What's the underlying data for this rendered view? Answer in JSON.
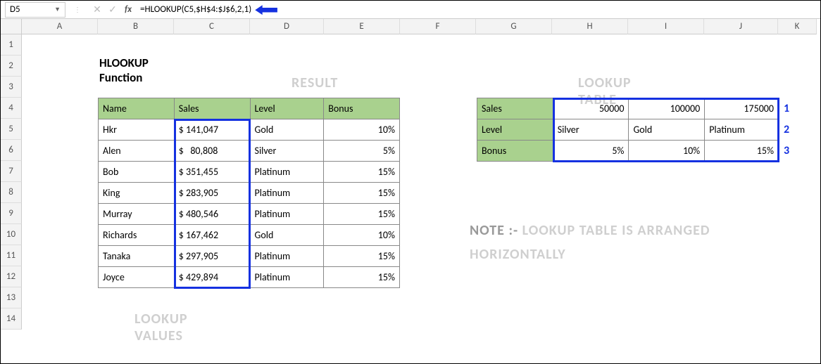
{
  "name_box": "D5",
  "formula": "=HLOOKUP(C5,$H$4:$J$6,2,1)",
  "columns": [
    "A",
    "B",
    "C",
    "D",
    "E",
    "F",
    "G",
    "H",
    "I",
    "J",
    "K"
  ],
  "rows": [
    "1",
    "2",
    "3",
    "4",
    "5",
    "6",
    "7",
    "8",
    "9",
    "10",
    "11",
    "12",
    "13",
    "14"
  ],
  "title": "HLOOKUP Function",
  "anno_result": "RESULT",
  "anno_lookup_values": "LOOKUP VALUES",
  "anno_lookup_table": "LOOKUP TABLE",
  "note_label": "NOTE :-",
  "note_text": "LOOKUP TABLE IS ARRANGED HORIZONTALLY",
  "main": {
    "hdr": {
      "name": "Name",
      "sales": "Sales",
      "level": "Level",
      "bonus": "Bonus"
    },
    "rows": [
      {
        "name": "Hkr",
        "sales": "$ 141,047",
        "level": "Gold",
        "bonus": "10%"
      },
      {
        "name": "Alen",
        "sales": "$   80,808",
        "level": "Silver",
        "bonus": "5%"
      },
      {
        "name": "Bob",
        "sales": "$ 351,455",
        "level": "Platinum",
        "bonus": "15%"
      },
      {
        "name": "King",
        "sales": "$ 283,905",
        "level": "Platinum",
        "bonus": "15%"
      },
      {
        "name": "Murray",
        "sales": "$ 480,546",
        "level": "Platinum",
        "bonus": "15%"
      },
      {
        "name": "Richards",
        "sales": "$ 167,462",
        "level": "Gold",
        "bonus": "10%"
      },
      {
        "name": "Tanaka",
        "sales": "$ 297,905",
        "level": "Platinum",
        "bonus": "15%"
      },
      {
        "name": "Joyce",
        "sales": "$ 429,894",
        "level": "Platinum",
        "bonus": "15%"
      }
    ]
  },
  "lookup": {
    "labels": {
      "sales": "Sales",
      "level": "Level",
      "bonus": "Bonus"
    },
    "sales": [
      "50000",
      "100000",
      "175000"
    ],
    "level": [
      "Silver",
      "Gold",
      "Platinum"
    ],
    "bonus": [
      "5%",
      "10%",
      "15%"
    ]
  },
  "row_tags": [
    "1",
    "2",
    "3"
  ]
}
